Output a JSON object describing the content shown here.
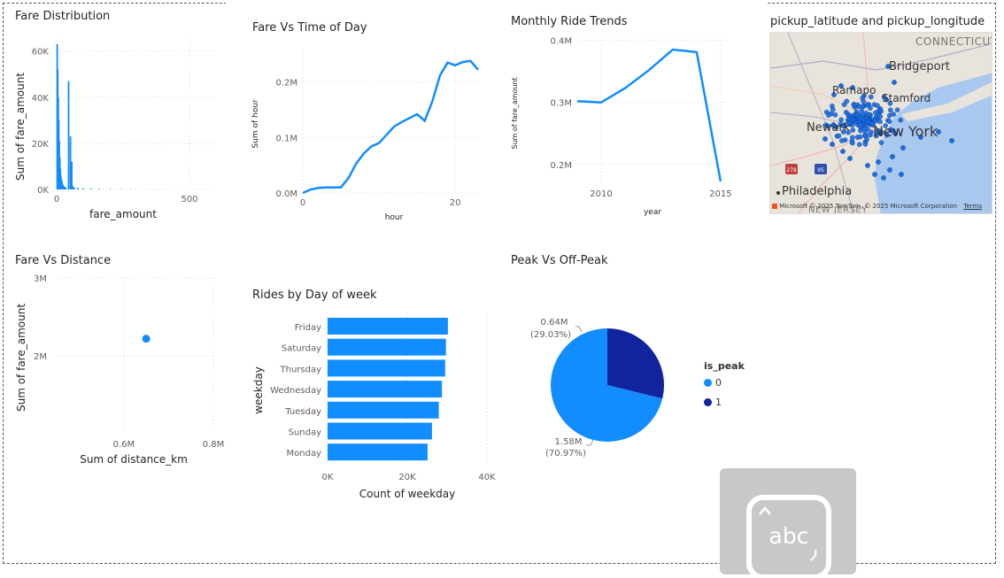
{
  "colors": {
    "primary": "#118DFF",
    "dark": "#12239E",
    "grid": "#d9d9d9",
    "axis_text": "#605E5C"
  },
  "fare_distribution": {
    "title": "Fare Distribution",
    "chart_data": {
      "type": "bar",
      "title": "Fare Distribution",
      "xlabel": "fare_amount",
      "ylabel": "Sum of fare_amount",
      "x_ticks": [
        "0",
        "500"
      ],
      "y_ticks": [
        "0K",
        "20K",
        "40K",
        "60K"
      ],
      "xlim": [
        0,
        600
      ],
      "ylim": [
        0,
        66000
      ],
      "bars": [
        {
          "x": 2,
          "y": 63000
        },
        {
          "x": 4,
          "y": 52000
        },
        {
          "x": 6,
          "y": 40000
        },
        {
          "x": 8,
          "y": 30000
        },
        {
          "x": 10,
          "y": 21000
        },
        {
          "x": 12,
          "y": 14000
        },
        {
          "x": 14,
          "y": 9000
        },
        {
          "x": 16,
          "y": 6000
        },
        {
          "x": 18,
          "y": 4500
        },
        {
          "x": 20,
          "y": 3500
        },
        {
          "x": 22,
          "y": 2500
        },
        {
          "x": 24,
          "y": 2000
        },
        {
          "x": 26,
          "y": 1500
        },
        {
          "x": 28,
          "y": 1200
        },
        {
          "x": 30,
          "y": 1000
        },
        {
          "x": 34,
          "y": 800
        },
        {
          "x": 45,
          "y": 47000
        },
        {
          "x": 52,
          "y": 23000
        },
        {
          "x": 57,
          "y": 12000
        },
        {
          "x": 60,
          "y": 1500
        },
        {
          "x": 66,
          "y": 900
        },
        {
          "x": 80,
          "y": 700
        },
        {
          "x": 100,
          "y": 500
        },
        {
          "x": 130,
          "y": 350
        },
        {
          "x": 160,
          "y": 250
        },
        {
          "x": 200,
          "y": 200
        },
        {
          "x": 240,
          "y": 150
        },
        {
          "x": 280,
          "y": 120
        }
      ]
    }
  },
  "fare_vs_time": {
    "title": "Fare Vs Time of Day",
    "chart_data": {
      "type": "line",
      "title": "Fare Vs Time of Day",
      "xlabel": "hour",
      "ylabel": "Sum of hour",
      "x_ticks": [
        "0",
        "20"
      ],
      "y_ticks": [
        "0.0M",
        "0.1M",
        "0.2M"
      ],
      "xlim": [
        0,
        23
      ],
      "ylim": [
        0,
        0.26
      ],
      "x": [
        0,
        1,
        2,
        3,
        4,
        5,
        6,
        7,
        8,
        9,
        10,
        11,
        12,
        13,
        14,
        15,
        16,
        17,
        18,
        19,
        20,
        21,
        22,
        23
      ],
      "y": [
        0.0,
        0.006,
        0.009,
        0.01,
        0.01,
        0.01,
        0.027,
        0.053,
        0.071,
        0.084,
        0.09,
        0.105,
        0.12,
        0.128,
        0.135,
        0.142,
        0.13,
        0.165,
        0.212,
        0.235,
        0.23,
        0.236,
        0.238,
        0.222
      ]
    }
  },
  "monthly_trends": {
    "title": "Monthly Ride Trends",
    "chart_data": {
      "type": "line",
      "title": "Monthly Ride Trends",
      "xlabel": "year",
      "ylabel": "Sum of fare_amount",
      "x_ticks": [
        "2010",
        "2015"
      ],
      "y_ticks": [
        "0.2M",
        "0.3M",
        "0.4M"
      ],
      "xlim": [
        2009,
        2015.3
      ],
      "ylim": [
        0.17,
        0.405
      ],
      "x": [
        2009,
        2010,
        2011,
        2012,
        2013,
        2014,
        2015
      ],
      "y": [
        0.302,
        0.3,
        0.323,
        0.352,
        0.385,
        0.381,
        0.173
      ]
    }
  },
  "map": {
    "title": "pickup_latitude and pickup_longitude",
    "labels": {
      "connecticut": "CONNECTICUT",
      "bridgeport": "Bridgeport",
      "ramapo": "Ramapo",
      "stamford": "Stamford",
      "newark": "Newark",
      "new_york": "New York",
      "philadelphia": "Philadelphia",
      "new_jersey": "NEW JERSEY",
      "shield_a": "278",
      "shield_b": "95"
    },
    "attribution": "© 2025 TomTom, © 2025 Microsoft Corporation",
    "terms": "Terms",
    "brand": "Microsoft"
  },
  "fare_vs_distance": {
    "title": "Fare Vs Distance",
    "chart_data": {
      "type": "scatter",
      "title": "Fare Vs Distance",
      "xlabel": "Sum of distance_km",
      "ylabel": "Sum of fare_amount",
      "x_ticks": [
        "0.6M",
        "0.8M"
      ],
      "y_ticks": [
        "2M",
        "3M"
      ],
      "xlim": [
        0.45,
        0.8
      ],
      "ylim": [
        1.0,
        3.0
      ],
      "points": [
        {
          "x": 0.65,
          "y": 2.22
        }
      ]
    }
  },
  "rides_by_day": {
    "title": "Rides by Day of week",
    "chart_data": {
      "type": "bar",
      "orientation": "horizontal",
      "title": "Rides by Day of week",
      "xlabel": "Count of weekday",
      "ylabel": "weekday",
      "x_ticks": [
        "0K",
        "20K",
        "40K"
      ],
      "xlim": [
        0,
        40000
      ],
      "categories": [
        "Friday",
        "Saturday",
        "Thursday",
        "Wednesday",
        "Tuesday",
        "Sunday",
        "Monday"
      ],
      "values": [
        30200,
        29700,
        29500,
        28700,
        27900,
        26200,
        25100
      ]
    }
  },
  "peak_vs_offpeak": {
    "title": "Peak Vs Off-Peak",
    "legend_title": "is_peak",
    "chart_data": {
      "type": "pie",
      "title": "Peak Vs Off-Peak",
      "legend": "right",
      "slices": [
        {
          "name": "0",
          "value": 1.58,
          "label": "1.58M",
          "pct": "(70.97%)"
        },
        {
          "name": "1",
          "value": 0.64,
          "label": "0.64M",
          "pct": "(29.03%)"
        }
      ]
    }
  },
  "placeholder_widget": {
    "text": "abc"
  }
}
